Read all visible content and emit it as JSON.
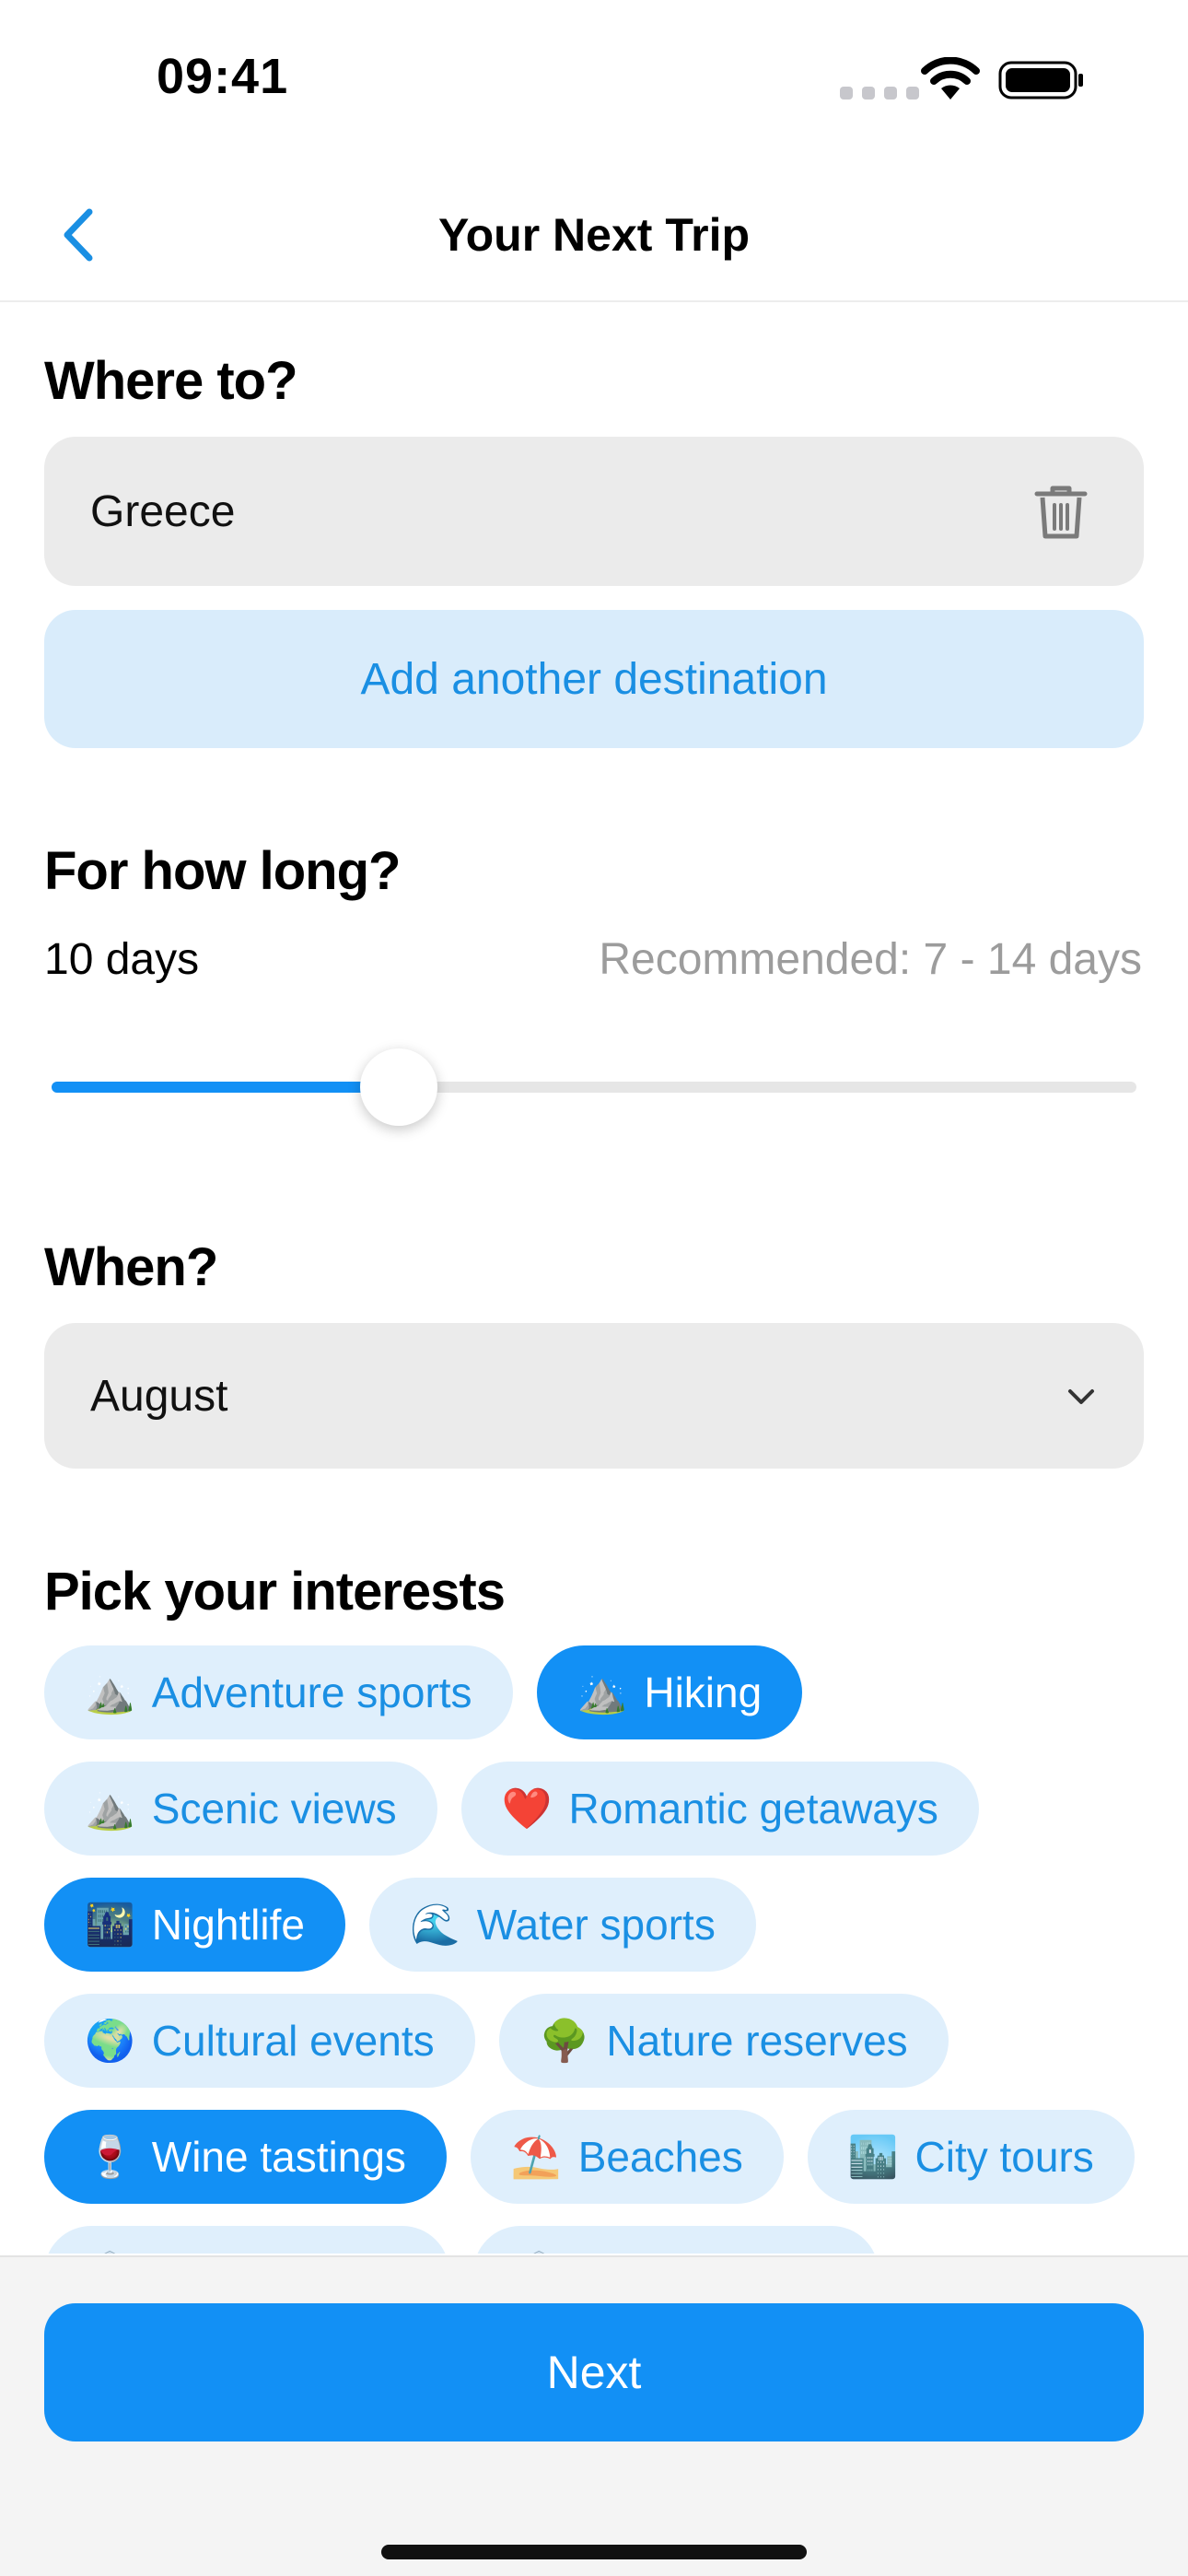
{
  "status_bar": {
    "time": "09:41"
  },
  "nav": {
    "title": "Your Next Trip",
    "back_icon": "chevron-left-icon"
  },
  "destination": {
    "heading": "Where to?",
    "value": "Greece",
    "delete_icon": "trash-icon",
    "add_label": "Add another destination"
  },
  "duration": {
    "heading": "For how long?",
    "value_label": "10 days",
    "recommended": "Recommended: 7 - 14 days",
    "slider_fraction": 0.32
  },
  "when": {
    "heading": "When?",
    "selected": "August",
    "dropdown_icon": "chevron-down-icon"
  },
  "interests": {
    "heading": "Pick your interests",
    "items": [
      {
        "emoji": "⛰️",
        "label": "Adventure sports",
        "selected": false
      },
      {
        "emoji": "⛰️",
        "label": "Hiking",
        "selected": true
      },
      {
        "emoji": "⛰️",
        "label": "Scenic views",
        "selected": false
      },
      {
        "emoji": "❤️",
        "label": "Romantic getaways",
        "selected": false
      },
      {
        "emoji": "🌃",
        "label": "Nightlife",
        "selected": true
      },
      {
        "emoji": "🌊",
        "label": "Water sports",
        "selected": false
      },
      {
        "emoji": "🌍",
        "label": "Cultural events",
        "selected": false
      },
      {
        "emoji": "🌳",
        "label": "Nature reserves",
        "selected": false
      },
      {
        "emoji": "🍷",
        "label": "Wine tastings",
        "selected": true
      },
      {
        "emoji": "⛱️",
        "label": "Beaches",
        "selected": false
      },
      {
        "emoji": "🏙️",
        "label": "City tours",
        "selected": false
      },
      {
        "emoji": "🏛️",
        "label": "",
        "selected": false
      },
      {
        "emoji": "🏛️",
        "label": "",
        "selected": false
      }
    ]
  },
  "footer": {
    "next_label": "Next"
  },
  "colors": {
    "accent": "#1290f5",
    "chip_bg": "#dfeffc",
    "field_bg": "#ebebeb",
    "muted_text": "#9c9c9c"
  }
}
